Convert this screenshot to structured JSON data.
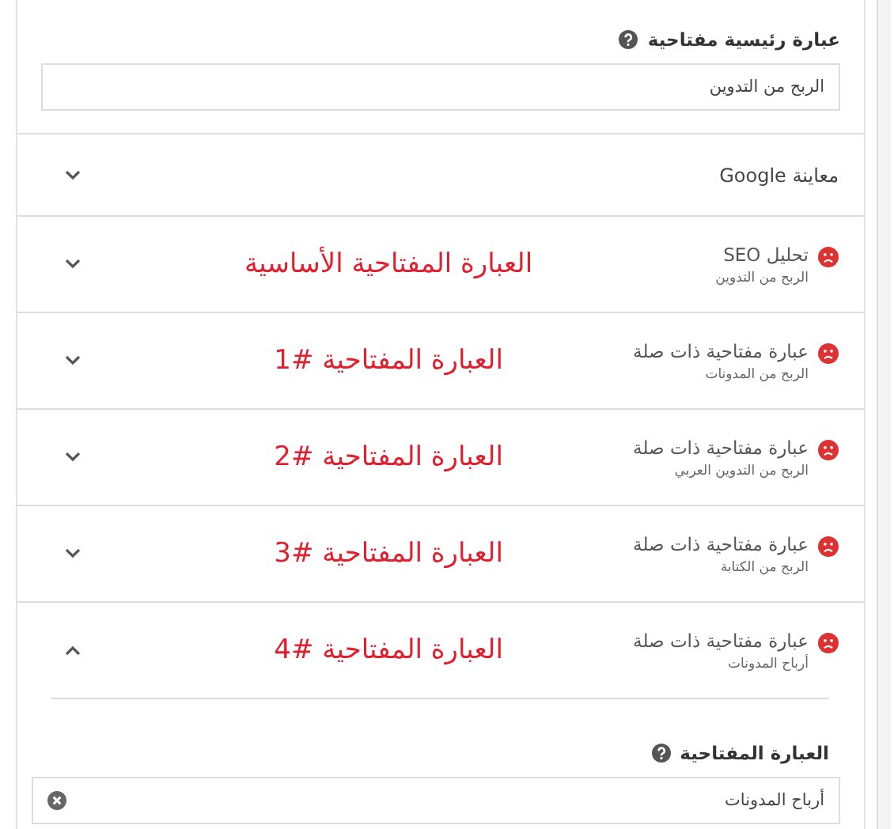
{
  "focus_keyphrase": {
    "label": "عبارة رئيسية مفتاحية",
    "value": "الربح من التدوين"
  },
  "sections": [
    {
      "kind": "plain",
      "title": "معاينة Google",
      "expanded": false
    },
    {
      "kind": "analysis",
      "title": "تحليل SEO",
      "subtitle": "الربح من التدوين",
      "color": "#dc3232",
      "annotation": "العبارة المفتاحية الأساسية",
      "expanded": false
    },
    {
      "kind": "analysis",
      "title": "عبارة مفتاحية ذات صلة",
      "subtitle": "الربح من المدونات",
      "color": "#dc3232",
      "annotation": "العبارة المفتاحية #1",
      "expanded": false
    },
    {
      "kind": "analysis",
      "title": "عبارة مفتاحية ذات صلة",
      "subtitle": "الربح من التدوين العربي",
      "color": "#dc3232",
      "annotation": "العبارة المفتاحية #2",
      "expanded": false
    },
    {
      "kind": "analysis",
      "title": "عبارة مفتاحية ذات صلة",
      "subtitle": "الربح من الكتابة",
      "color": "#dc3232",
      "annotation": "العبارة المفتاحية #3",
      "expanded": false
    },
    {
      "kind": "analysis",
      "title": "عبارة مفتاحية ذات صلة",
      "subtitle": "أرباح المدونات",
      "color": "#dc3232",
      "annotation": "العبارة المفتاحية #4",
      "expanded": true,
      "content": {
        "label": "العبارة المفتاحية",
        "value": "أرباح المدونات"
      }
    }
  ]
}
